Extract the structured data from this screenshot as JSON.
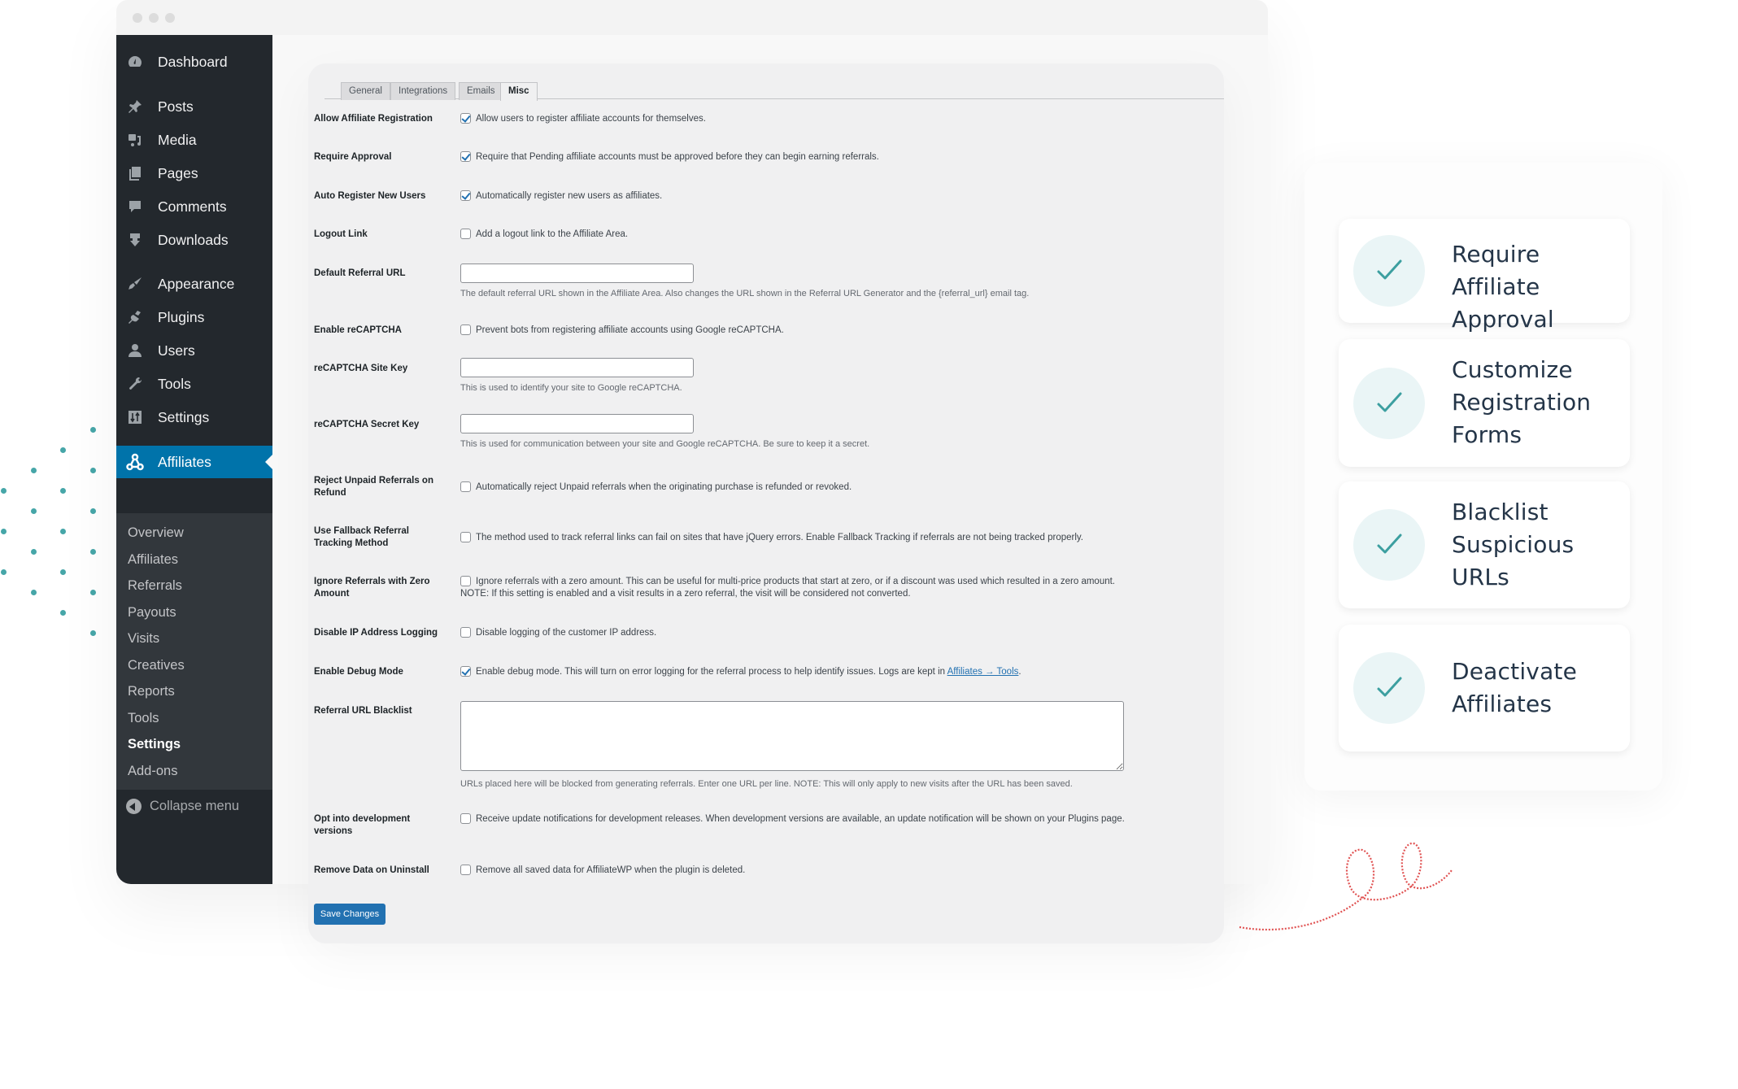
{
  "sidebar": {
    "items": [
      {
        "label": "Dashboard",
        "icon": "dashboard-icon"
      },
      {
        "label": "Posts",
        "icon": "pin-icon"
      },
      {
        "label": "Media",
        "icon": "media-icon"
      },
      {
        "label": "Pages",
        "icon": "pages-icon"
      },
      {
        "label": "Comments",
        "icon": "comment-icon"
      },
      {
        "label": "Downloads",
        "icon": "download-icon"
      },
      {
        "label": "Appearance",
        "icon": "paintbrush-icon"
      },
      {
        "label": "Plugins",
        "icon": "plugin-icon"
      },
      {
        "label": "Users",
        "icon": "user-icon"
      },
      {
        "label": "Tools",
        "icon": "wrench-icon"
      },
      {
        "label": "Settings",
        "icon": "sliders-icon"
      },
      {
        "label": "Affiliates",
        "icon": "affiliates-icon"
      }
    ],
    "submenu": [
      "Overview",
      "Affiliates",
      "Referrals",
      "Payouts",
      "Visits",
      "Creatives",
      "Reports",
      "Tools",
      "Settings",
      "Add-ons"
    ],
    "current_submenu": "Settings",
    "collapse_label": "Collapse menu"
  },
  "tabs": [
    {
      "label": "General",
      "active": false
    },
    {
      "label": "Integrations",
      "active": false
    },
    {
      "label": "Emails",
      "active": false
    },
    {
      "label": "Misc",
      "active": true
    }
  ],
  "settings": {
    "allow_registration": {
      "label": "Allow Affiliate Registration",
      "checked": true,
      "text": "Allow users to register affiliate accounts for themselves."
    },
    "require_approval": {
      "label": "Require Approval",
      "checked": true,
      "text": "Require that Pending affiliate accounts must be approved before they can begin earning referrals."
    },
    "auto_register": {
      "label": "Auto Register New Users",
      "checked": true,
      "text": "Automatically register new users as affiliates."
    },
    "logout_link": {
      "label": "Logout Link",
      "checked": false,
      "text": "Add a logout link to the Affiliate Area."
    },
    "default_referral_url": {
      "label": "Default Referral URL",
      "value": "",
      "desc": "The default referral URL shown in the Affiliate Area. Also changes the URL shown in the Referral URL Generator and the {referral_url} email tag."
    },
    "enable_recaptcha": {
      "label": "Enable reCAPTCHA",
      "checked": false,
      "text": "Prevent bots from registering affiliate accounts using Google reCAPTCHA."
    },
    "recaptcha_site_key": {
      "label": "reCAPTCHA Site Key",
      "value": "",
      "desc": "This is used to identify your site to Google reCAPTCHA."
    },
    "recaptcha_secret_key": {
      "label": "reCAPTCHA Secret Key",
      "value": "",
      "desc": "This is used for communication between your site and Google reCAPTCHA. Be sure to keep it a secret."
    },
    "reject_unpaid": {
      "label": "Reject Unpaid Referrals on Refund",
      "checked": false,
      "text": "Automatically reject Unpaid referrals when the originating purchase is refunded or revoked."
    },
    "fallback_tracking": {
      "label": "Use Fallback Referral Tracking Method",
      "checked": false,
      "text": "The method used to track referral links can fail on sites that have jQuery errors. Enable Fallback Tracking if referrals are not being tracked properly."
    },
    "ignore_zero": {
      "label": "Ignore Referrals with Zero Amount",
      "checked": false,
      "text": "Ignore referrals with a zero amount. This can be useful for multi-price products that start at zero, or if a discount was used which resulted in a zero amount. NOTE: If this setting is enabled and a visit results in a zero referral, the visit will be considered not converted."
    },
    "disable_ip": {
      "label": "Disable IP Address Logging",
      "checked": false,
      "text": "Disable logging of the customer IP address."
    },
    "debug_mode": {
      "label": "Enable Debug Mode",
      "checked": true,
      "text": "Enable debug mode. This will turn on error logging for the referral process to help identify issues. Logs are kept in ",
      "link": "Affiliates → Tools",
      "suffix": "."
    },
    "url_blacklist": {
      "label": "Referral URL Blacklist",
      "value": "",
      "desc": "URLs placed here will be blocked from generating referrals. Enter one URL per line. NOTE: This will only apply to new visits after the URL has been saved."
    },
    "dev_versions": {
      "label": "Opt into development versions",
      "checked": false,
      "text": "Receive update notifications for development releases. When development versions are available, an update notification will be shown on your Plugins page."
    },
    "remove_data": {
      "label": "Remove Data on Uninstall",
      "checked": false,
      "text": "Remove all saved data for AffiliateWP when the plugin is deleted."
    }
  },
  "save_label": "Save Changes",
  "features": [
    {
      "label": "Require Affiliate Approval",
      "lines": [
        "Require Affiliate",
        "Approval"
      ]
    },
    {
      "label": "Customize Registration Forms",
      "lines": [
        "Customize",
        "Registration",
        "Forms"
      ]
    },
    {
      "label": "Blacklist Suspicious URLs",
      "lines": [
        "Blacklist",
        "Suspicious",
        "URLs"
      ]
    },
    {
      "label": "Deactivate Affiliates",
      "lines": [
        "Deactivate",
        "Affiliates"
      ]
    }
  ],
  "colors": {
    "accent": "#0073aa",
    "button": "#2271b1",
    "teal": "#46a6a8",
    "squiggle": "#e05252"
  }
}
